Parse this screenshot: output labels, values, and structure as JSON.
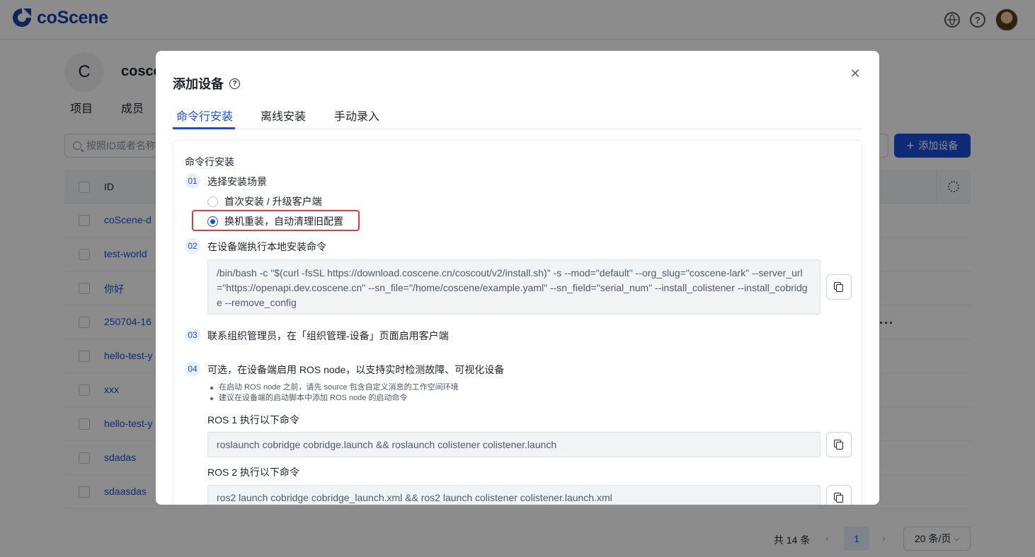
{
  "app": {
    "logo_text": "coScene"
  },
  "org": {
    "avatar_letter": "C",
    "name": "cosce",
    "tabs": [
      "项目",
      "成员"
    ]
  },
  "toolbar": {
    "search_placeholder": "按照ID或者名称",
    "add_device_label": "添加设备",
    "add_icon": "plus-icon"
  },
  "table": {
    "id_header": "ID",
    "rows": [
      "coScene-d",
      "test-world",
      "你好",
      "250704-16",
      "hello-test-y",
      "xxx",
      "hello-test-y",
      "sdadas",
      "sdaasdas"
    ],
    "more": "···"
  },
  "pagination": {
    "total": "共 14 条",
    "prev": "‹",
    "next": "›",
    "current_page": "1",
    "page_size": "20 条/页"
  },
  "modal": {
    "title": "添加设备",
    "close": "✕",
    "tabs": [
      "命令行安装",
      "离线安装",
      "手动录入"
    ],
    "active_tab": 0,
    "section_title": "命令行安装",
    "steps": {
      "s1": {
        "num": "01",
        "text": "选择安装场景"
      },
      "s2": {
        "num": "02",
        "text": "在设备端执行本地安装命令"
      },
      "s3": {
        "num": "03",
        "text": "联系组织管理员，在「组织管理-设备」页面启用客户端"
      },
      "s4": {
        "num": "04",
        "text": "可选，在设备端启用 ROS node，以支持实时检测故障、可视化设备"
      }
    },
    "radios": [
      {
        "label": "首次安装 / 升级客户端",
        "checked": false
      },
      {
        "label": "换机重装，自动清理旧配置",
        "checked": true
      }
    ],
    "install_command": "/bin/bash -c \"$(curl -fsSL https://download.coscene.cn/coscout/v2/install.sh)\" -s --mod=\"default\" --org_slug=\"coscene-lark\" --server_url=\"https://openapi.dev.coscene.cn\" --sn_file=\"/home/coscene/example.yaml\" --sn_field=\"serial_num\" --install_colistener --install_cobridge --remove_config",
    "ros_notes": [
      "在启动 ROS node 之前，请先 source 包含自定义消息的工作空间环境",
      "建议在设备端的启动脚本中添加 ROS node 的启动命令"
    ],
    "ros1": {
      "label": "ROS 1 执行以下命令",
      "command": "roslaunch cobridge cobridge.launch && roslaunch colistener colistener.launch"
    },
    "ros2": {
      "label": "ROS 2 执行以下命令",
      "command": "ros2 launch cobridge cobridge_launch.xml && ros2 launch colistener colistener.launch.xml"
    }
  }
}
